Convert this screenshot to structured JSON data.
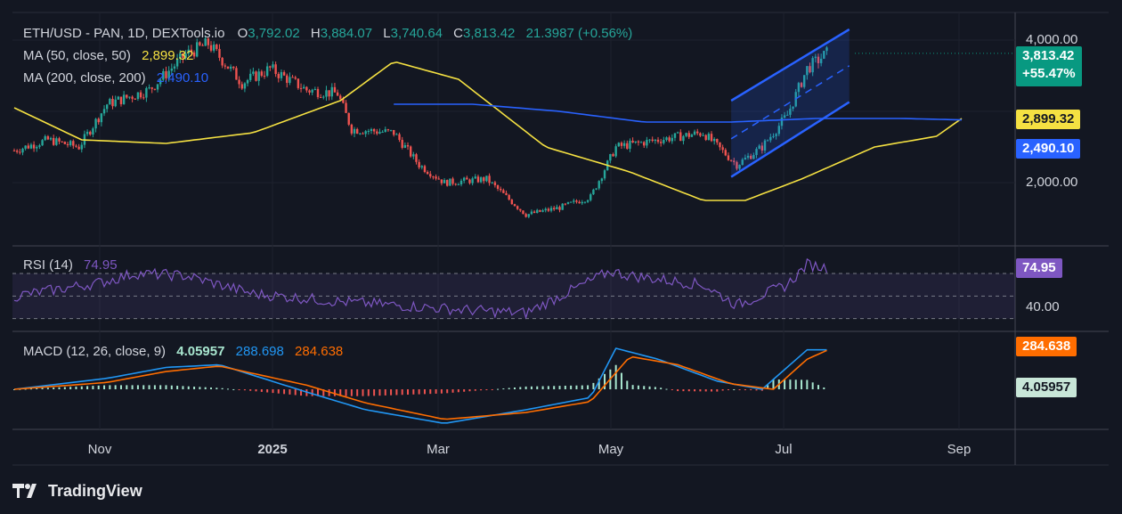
{
  "header": {
    "symbol": "ETH/USD - PAN, 1D, DEXTools.io",
    "o_label": "O",
    "o": "3,792.02",
    "h_label": "H",
    "h": "3,884.07",
    "l_label": "L",
    "l": "3,740.64",
    "c_label": "C",
    "c": "3,813.42",
    "change": "21.3987 (+0.56%)"
  },
  "ma50": {
    "label": "MA (50, close, 50)",
    "value": "2,899.32",
    "color": "#f5e142"
  },
  "ma200": {
    "label": "MA (200, close, 200)",
    "value": "2,490.10",
    "color": "#2962ff"
  },
  "price_tags": {
    "last": "3,813.42",
    "last_change": "+55.47%",
    "last_color": "#089981",
    "ma50": "2,899.32",
    "ma200": "2,490.10"
  },
  "price_axis": {
    "labels": [
      "4,000.00",
      "2,000.00"
    ]
  },
  "rsi": {
    "label": "RSI (14)",
    "value": "74.95",
    "axis_label": "40.00",
    "color": "#7e57c2"
  },
  "macd": {
    "label": "MACD (12, 26, close, 9)",
    "hist": "4.05957",
    "macd": "288.698",
    "signal": "284.638",
    "macd_color": "#2196f3",
    "signal_color": "#ff6d00",
    "hist_up_color": "#a8e6cf",
    "hist_down_color": "#ef5350"
  },
  "brand": "TradingView",
  "chart_data": {
    "type": "candlestick",
    "x_ticks": [
      "Nov",
      "2025",
      "Mar",
      "May",
      "Jul",
      "Sep"
    ],
    "price_close_series": {
      "name": "ETH/USD",
      "x": [
        "2024-10-08",
        "2024-10-20",
        "2024-10-31",
        "2024-11-10",
        "2024-11-25",
        "2024-12-08",
        "2024-12-16",
        "2024-12-28",
        "2025-01-07",
        "2025-01-20",
        "2025-01-31",
        "2025-02-05",
        "2025-02-20",
        "2025-03-01",
        "2025-03-10",
        "2025-03-25",
        "2025-04-08",
        "2025-04-20",
        "2025-05-01",
        "2025-05-10",
        "2025-05-25",
        "2025-06-10",
        "2025-06-22",
        "2025-07-01",
        "2025-07-10",
        "2025-07-17",
        "2025-07-24"
      ],
      "values": [
        2450,
        2600,
        2500,
        3100,
        3300,
        3800,
        3950,
        3400,
        3600,
        3300,
        3250,
        2750,
        2700,
        2250,
        2000,
        2050,
        1550,
        1650,
        1800,
        2500,
        2600,
        2700,
        2250,
        2500,
        2950,
        3600,
        3813
      ]
    },
    "ma50_series": {
      "name": "MA (50, close, 50)",
      "x": [
        "2024-10-08",
        "2024-11-01",
        "2024-12-01",
        "2025-01-01",
        "2025-02-01",
        "2025-02-20",
        "2025-03-15",
        "2025-04-15",
        "2025-05-15",
        "2025-06-10",
        "2025-06-25",
        "2025-07-15",
        "2025-08-10",
        "2025-09-01",
        "2025-09-10"
      ],
      "values": [
        3050,
        2600,
        2550,
        2700,
        3150,
        3700,
        3450,
        2500,
        2150,
        1750,
        1750,
        2050,
        2500,
        2650,
        2900
      ]
    },
    "ma200_series": {
      "name": "MA (200, close, 200)",
      "x": [
        "2025-02-20",
        "2025-03-20",
        "2025-04-20",
        "2025-05-20",
        "2025-06-20",
        "2025-07-20",
        "2025-08-20",
        "2025-09-10"
      ],
      "values": [
        3100,
        3100,
        3000,
        2850,
        2850,
        2900,
        2900,
        2880
      ]
    },
    "channel": {
      "upper": [
        [
          "2025-06-20",
          3150
        ],
        [
          "2025-08-01",
          4150
        ]
      ],
      "lower": [
        [
          "2025-06-20",
          2080
        ],
        [
          "2025-08-01",
          3130
        ]
      ]
    },
    "ylim": [
      1300,
      4200
    ],
    "rsi_series": {
      "name": "RSI (14)",
      "x": [
        "2024-10-08",
        "2024-11-08",
        "2024-11-20",
        "2024-12-08",
        "2025-01-01",
        "2025-02-01",
        "2025-02-20",
        "2025-03-15",
        "2025-04-08",
        "2025-05-08",
        "2025-05-15",
        "2025-06-10",
        "2025-06-22",
        "2025-07-10",
        "2025-07-17",
        "2025-07-24"
      ],
      "values": [
        50,
        62,
        70,
        68,
        52,
        45,
        42,
        38,
        35,
        72,
        68,
        60,
        42,
        60,
        78,
        74.95
      ]
    },
    "macd_series": {
      "name": "MACD",
      "x": [
        "2024-10-08",
        "2024-11-10",
        "2024-12-01",
        "2024-12-20",
        "2025-01-20",
        "2025-02-10",
        "2025-03-10",
        "2025-04-08",
        "2025-05-01",
        "2025-05-10",
        "2025-05-25",
        "2025-06-15",
        "2025-07-01",
        "2025-07-17",
        "2025-07-24"
      ],
      "values": [
        0,
        80,
        160,
        180,
        -20,
        -150,
        -250,
        -150,
        -60,
        300,
        220,
        60,
        0,
        288.698,
        288.698
      ]
    },
    "signal_series": {
      "name": "Signal",
      "x": [
        "2024-10-08",
        "2024-11-10",
        "2024-12-01",
        "2024-12-20",
        "2025-01-20",
        "2025-02-10",
        "2025-03-10",
        "2025-04-08",
        "2025-05-01",
        "2025-05-15",
        "2025-06-01",
        "2025-06-20",
        "2025-07-05",
        "2025-07-17",
        "2025-07-24"
      ],
      "values": [
        0,
        50,
        130,
        170,
        30,
        -100,
        -220,
        -170,
        -90,
        240,
        180,
        40,
        0,
        220,
        284.638
      ]
    }
  }
}
